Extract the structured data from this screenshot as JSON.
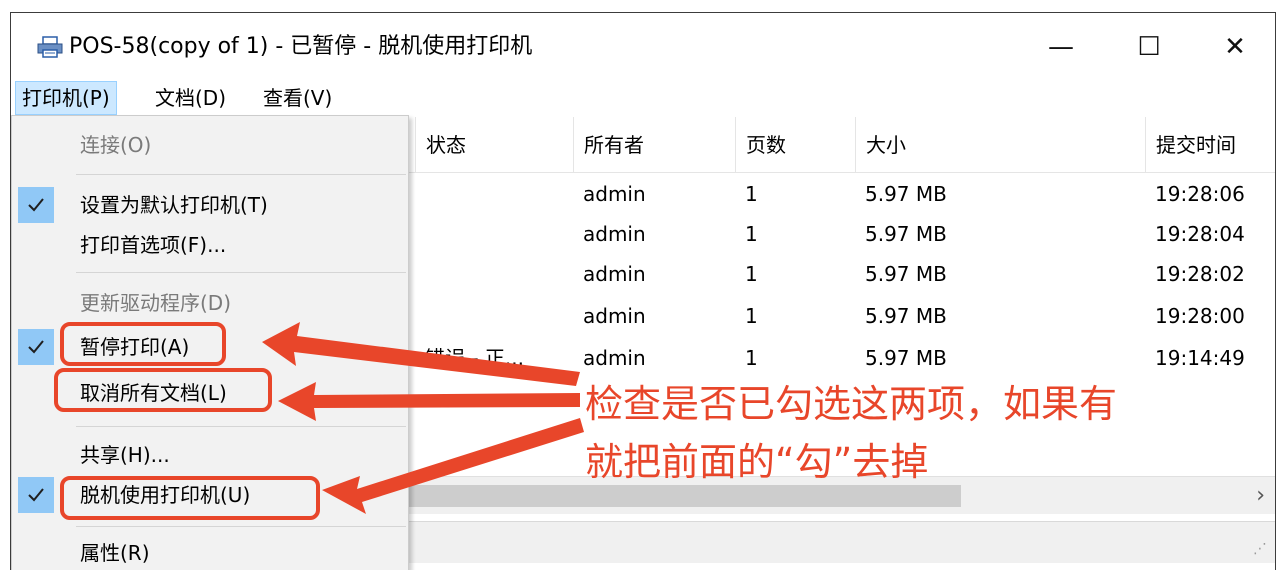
{
  "window": {
    "title": "POS-58(copy of 1) - 已暂停  -  脱机使用打印机",
    "minimize": "—",
    "maximize": "☐",
    "close": "✕"
  },
  "menubar": {
    "printer": "打印机(P)",
    "document": "文档(D)",
    "view": "查看(V)"
  },
  "columns": [
    "状态",
    "所有者",
    "页数",
    "大小",
    "提交时间"
  ],
  "jobs": [
    {
      "status": "",
      "owner": "admin",
      "pages": "1",
      "size": "5.97 MB",
      "time": "19:28:06"
    },
    {
      "status": "",
      "owner": "admin",
      "pages": "1",
      "size": "5.97 MB",
      "time": "19:28:04"
    },
    {
      "status": "",
      "owner": "admin",
      "pages": "1",
      "size": "5.97 MB",
      "time": "19:28:02"
    },
    {
      "status": "",
      "owner": "admin",
      "pages": "1",
      "size": "5.97 MB",
      "time": "19:28:00"
    },
    {
      "status": "错误 - 正...",
      "owner": "admin",
      "pages": "1",
      "size": "5.97 MB",
      "time": "19:14:49"
    }
  ],
  "printer_menu": {
    "connect": "连接(O)",
    "set_default": "设置为默认打印机(T)",
    "preferences": "打印首选项(F)...",
    "update_driver": "更新驱动程序(D)",
    "pause": "暂停打印(A)",
    "cancel_all": "取消所有文档(L)",
    "share": "共享(H)...",
    "offline": "脱机使用打印机(U)",
    "properties": "属性(R)"
  },
  "annotation": {
    "line1": "检查是否已勾选这两项，如果有",
    "line2": "就把前面的“勾”去掉"
  },
  "scroll": {
    "right_arrow": "›",
    "grip": "⋰"
  },
  "colors": {
    "annotation": "#e8462a",
    "check_bg": "#90c8f6",
    "menu_active": "#cce8ff"
  }
}
